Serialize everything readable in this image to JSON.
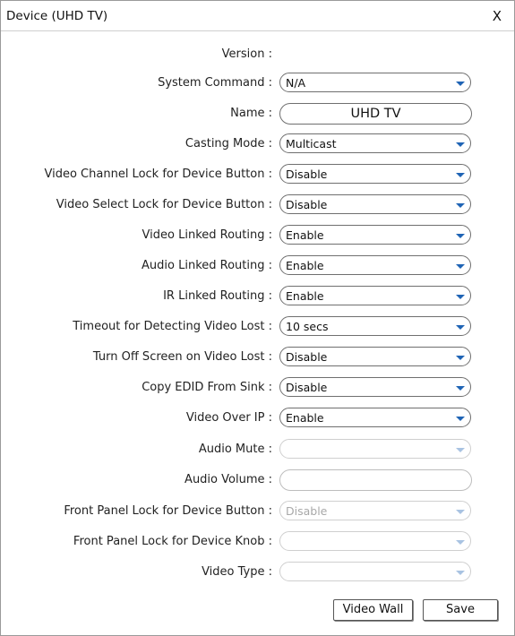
{
  "window": {
    "title": "Device (UHD TV)",
    "close_label": "X"
  },
  "fields": {
    "version": {
      "label": "Version :"
    },
    "system_command": {
      "label": "System Command :",
      "value": "N/A"
    },
    "name": {
      "label": "Name :",
      "value": "UHD TV"
    },
    "casting_mode": {
      "label": "Casting Mode :",
      "value": "Multicast"
    },
    "video_channel_lock": {
      "label": "Video Channel Lock for Device Button :",
      "value": "Disable"
    },
    "video_select_lock": {
      "label": "Video Select Lock for Device Button :",
      "value": "Disable"
    },
    "video_linked_routing": {
      "label": "Video Linked Routing :",
      "value": "Enable"
    },
    "audio_linked_routing": {
      "label": "Audio Linked Routing :",
      "value": "Enable"
    },
    "ir_linked_routing": {
      "label": "IR Linked Routing :",
      "value": "Enable"
    },
    "timeout_video_lost": {
      "label": "Timeout for Detecting Video Lost :",
      "value": "10 secs"
    },
    "turn_off_screen": {
      "label": "Turn Off Screen on Video Lost :",
      "value": "Disable"
    },
    "copy_edid": {
      "label": "Copy EDID From Sink :",
      "value": "Disable"
    },
    "video_over_ip": {
      "label": "Video Over IP :",
      "value": "Enable"
    },
    "audio_mute": {
      "label": "Audio Mute :",
      "value": ""
    },
    "audio_volume": {
      "label": "Audio Volume :",
      "value": ""
    },
    "front_panel_lock_button": {
      "label": "Front Panel Lock for Device Button :",
      "value": "Disable"
    },
    "front_panel_lock_knob": {
      "label": "Front Panel Lock for Device Knob :",
      "value": ""
    },
    "video_type": {
      "label": "Video Type :",
      "value": ""
    }
  },
  "buttons": {
    "video_wall": "Video Wall",
    "save": "Save"
  },
  "colors": {
    "arrow_active": "#1f64b5",
    "arrow_disabled": "#a9c3e2",
    "border": "#6f6f6f"
  },
  "icons": {
    "dropdown": "chevron-down-icon"
  }
}
